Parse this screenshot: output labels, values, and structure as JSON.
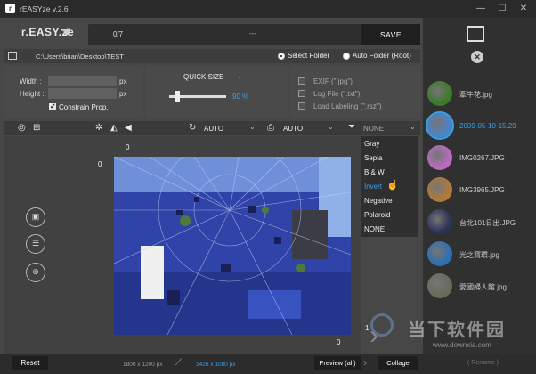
{
  "window": {
    "title": "rEASYze v.2.6",
    "logo_letter": "r"
  },
  "app": {
    "logo": "r.EASY.ze"
  },
  "progress": {
    "count": "0/7",
    "text": "---"
  },
  "toolbar_top": {
    "save_label": "SAVE"
  },
  "path": {
    "text": "C:\\Users\\brian\\Desktop\\TEST"
  },
  "folder_mode": {
    "select_label": "Select Folder",
    "auto_label": "Auto Folder (Root)"
  },
  "size": {
    "width_label": "Width :",
    "height_label": "Height :",
    "px_unit": "px",
    "constrain_label": "Constrain Prop.",
    "constrain_checked": true
  },
  "quick_size": {
    "label": "QUICK SIZE",
    "value": 90,
    "value_text": "90 %"
  },
  "options": {
    "exif_label": "EXIF (\".jpg\")",
    "log_label": "Log File (\".txt\")",
    "labeling_label": "Load Labeling (\".rsz\")"
  },
  "effects": {
    "rotate_value": "AUTO",
    "print_value": "AUTO",
    "filter_value": "NONE"
  },
  "filter_menu": {
    "items": [
      "Gray",
      "Sepia",
      "B & W",
      "Invert",
      "Negative",
      "Polaroid",
      "NONE"
    ],
    "selected": "Invert"
  },
  "canvas": {
    "offset_top": "0",
    "offset_left": "0",
    "corner_value": "0",
    "page_value": "1"
  },
  "files": [
    {
      "name": "牽牛花.jpg",
      "color": "#3d7a2a"
    },
    {
      "name": "2009-05-10-15.29",
      "color": "#4a84c9",
      "selected": true
    },
    {
      "name": "IMG0267.JPG",
      "color": "#b86cc0"
    },
    {
      "name": "IMG3965.JPG",
      "color": "#b07a3a"
    },
    {
      "name": "台北101日出.JPG",
      "color": "#2a3458"
    },
    {
      "name": "光之寶環.jpg",
      "color": "#2e6fb0"
    },
    {
      "name": "愛國婦人館.jpg",
      "color": "#6a6a5a"
    }
  ],
  "bottom": {
    "reset_label": "Reset",
    "orig_size": "1800 x 1200 px",
    "new_size": "1426 x 1080 px",
    "preview_label": "Preview (all)",
    "collage_label": "Collage",
    "rename_label": "( Rename )"
  },
  "watermark": {
    "cn": "当下软件园",
    "url": "www.downxia.com"
  },
  "colors": {
    "accent": "#3aa0e8",
    "background": "#474747",
    "sidebar": "#303030"
  }
}
